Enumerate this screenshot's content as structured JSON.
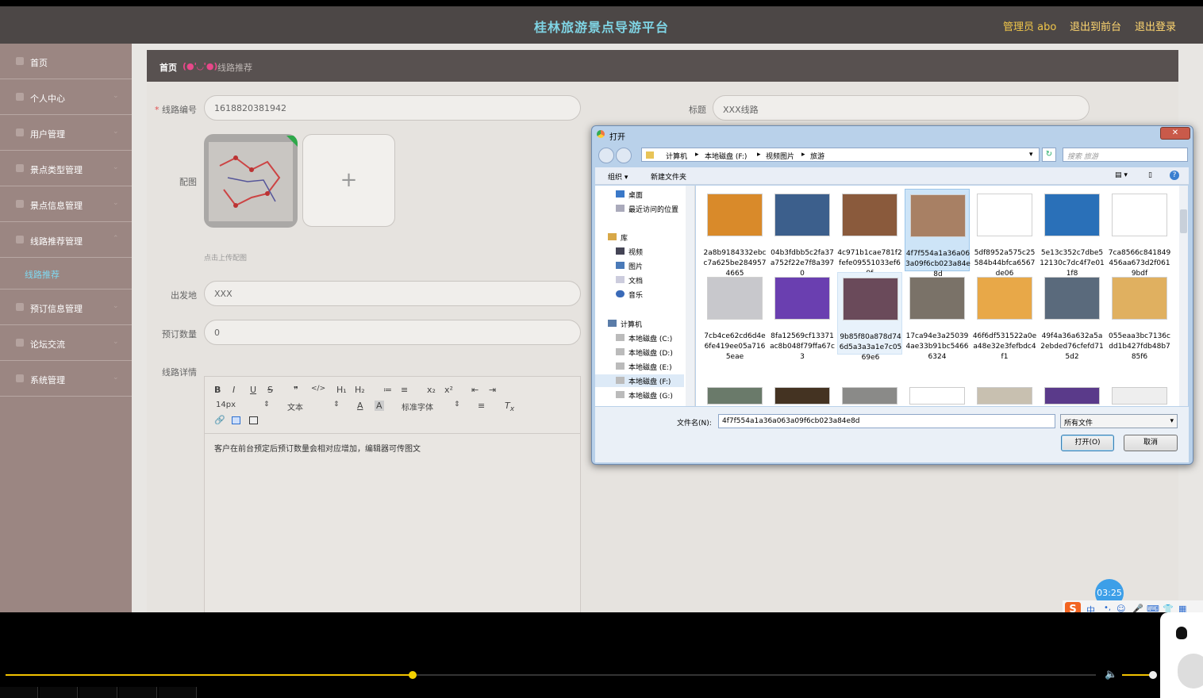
{
  "header": {
    "title": "桂林旅游景点导游平台",
    "admin": "管理员 abo",
    "link_front": "退出到前台",
    "link_logout": "退出登录"
  },
  "sidebar": {
    "items": [
      {
        "label": "首页"
      },
      {
        "label": "个人中心"
      },
      {
        "label": "用户管理"
      },
      {
        "label": "景点类型管理"
      },
      {
        "label": "景点信息管理"
      },
      {
        "label": "线路推荐管理"
      },
      {
        "label": "预订信息管理"
      },
      {
        "label": "论坛交流"
      },
      {
        "label": "系统管理"
      }
    ],
    "sub_item": "线路推荐"
  },
  "breadcrumb": {
    "home": "首页",
    "emoticon": "(●'◡'●)",
    "current": "线路推荐"
  },
  "form": {
    "route_no_label": "线路编号",
    "route_no_value": "1618820381942",
    "title_label": "标题",
    "title_value": "XXX线路",
    "image_label": "配图",
    "upload_hint": "点击上传配图",
    "plus": "+",
    "departure_label": "出发地",
    "departure_value": "XXX",
    "booking_label": "预订数量",
    "booking_value": "0",
    "detail_label": "线路详情",
    "required_mark": "*"
  },
  "editor": {
    "toolbar_row1": [
      "B",
      "I",
      "U",
      "S",
      "❞",
      "</>",
      "H₁",
      "H₂",
      "≔",
      "≡",
      "x₂",
      "x²",
      "⇤",
      "⇥"
    ],
    "font_size": "14px",
    "block_type": "文本",
    "font_family": "标准字体",
    "content": "客户在前台预定后预订数量会相对应增加，编辑器可传图文"
  },
  "dialog": {
    "title": "打开",
    "close": "✕",
    "path": [
      "计算机",
      "本地磁盘 (F:)",
      "视频图片",
      "旅游"
    ],
    "search_placeholder": "搜索 旅游",
    "organize": "组织 ▾",
    "new_folder": "新建文件夹",
    "tree": [
      {
        "label": "桌面",
        "icon": "desktop-icon"
      },
      {
        "label": "最近访问的位置",
        "icon": "recent-icon"
      },
      {
        "label": "库",
        "icon": "library-icon"
      },
      {
        "label": "视频",
        "icon": "video-icon"
      },
      {
        "label": "图片",
        "icon": "picture-icon"
      },
      {
        "label": "文档",
        "icon": "document-icon"
      },
      {
        "label": "音乐",
        "icon": "music-icon"
      },
      {
        "label": "计算机",
        "icon": "computer-icon"
      },
      {
        "label": "本地磁盘 (C:)",
        "icon": "drive-icon"
      },
      {
        "label": "本地磁盘 (D:)",
        "icon": "drive-icon"
      },
      {
        "label": "本地磁盘 (E:)",
        "icon": "drive-icon"
      },
      {
        "label": "本地磁盘 (F:)",
        "icon": "drive-icon"
      },
      {
        "label": "本地磁盘 (G:)",
        "icon": "drive-icon"
      }
    ],
    "files": [
      {
        "name": "2a8b9184332ebcc7a625be2849574665",
        "color": "#d98a2a"
      },
      {
        "name": "04b3fdbb5c2fa37a752f22e7f8a3970",
        "color": "#3c5f8c"
      },
      {
        "name": "4c971b1cae781f2fefe09551033ef69f",
        "color": "#8a5a3c"
      },
      {
        "name": "4f7f554a1a36a063a09f6cb023a84e8d",
        "color": "#a88064",
        "selected": true
      },
      {
        "name": "5df8952a575c25584b44bfca6567de06",
        "color": "#ffffff"
      },
      {
        "name": "5e13c352c7dbe512130c7dc4f7e011f8",
        "color": "#2a70b8"
      },
      {
        "name": "7ca8566c841849456aa673d2f0619bdf",
        "color": "#ffffff"
      },
      {
        "name": "7cb4ce62cd6d4e6fe419ee05a7165eae",
        "color": "#c8c8cc"
      },
      {
        "name": "8fa12569cf13371ac8b048f79ffa67c3",
        "color": "#6a3fb0"
      },
      {
        "name": "9b85f80a878d746d5a3a3a1e7c0569e6",
        "color": "#6a4a5a",
        "hover": true
      },
      {
        "name": "17ca94e3a250394ae33b91bc54666324",
        "color": "#7a7268"
      },
      {
        "name": "46f6df531522a0ea48e32e3fefbdc4f1",
        "color": "#e8a848"
      },
      {
        "name": "49f4a36a632a5a2ebded76cfefd715d2",
        "color": "#5a6a7c"
      },
      {
        "name": "055eaa3bc7136cdd1b427fdb48b785f6",
        "color": "#e0b060"
      }
    ],
    "file_name_label": "文件名(N):",
    "file_name_value": "4f7f554a1a36a063a09f6cb023a84e8d",
    "file_type": "所有文件",
    "open_button": "打开(O)",
    "cancel_button": "取消"
  },
  "overlay": {
    "timer": "03:25",
    "ime_cn": "中"
  },
  "player": {
    "progress": 0.373,
    "volume": 0.85
  }
}
